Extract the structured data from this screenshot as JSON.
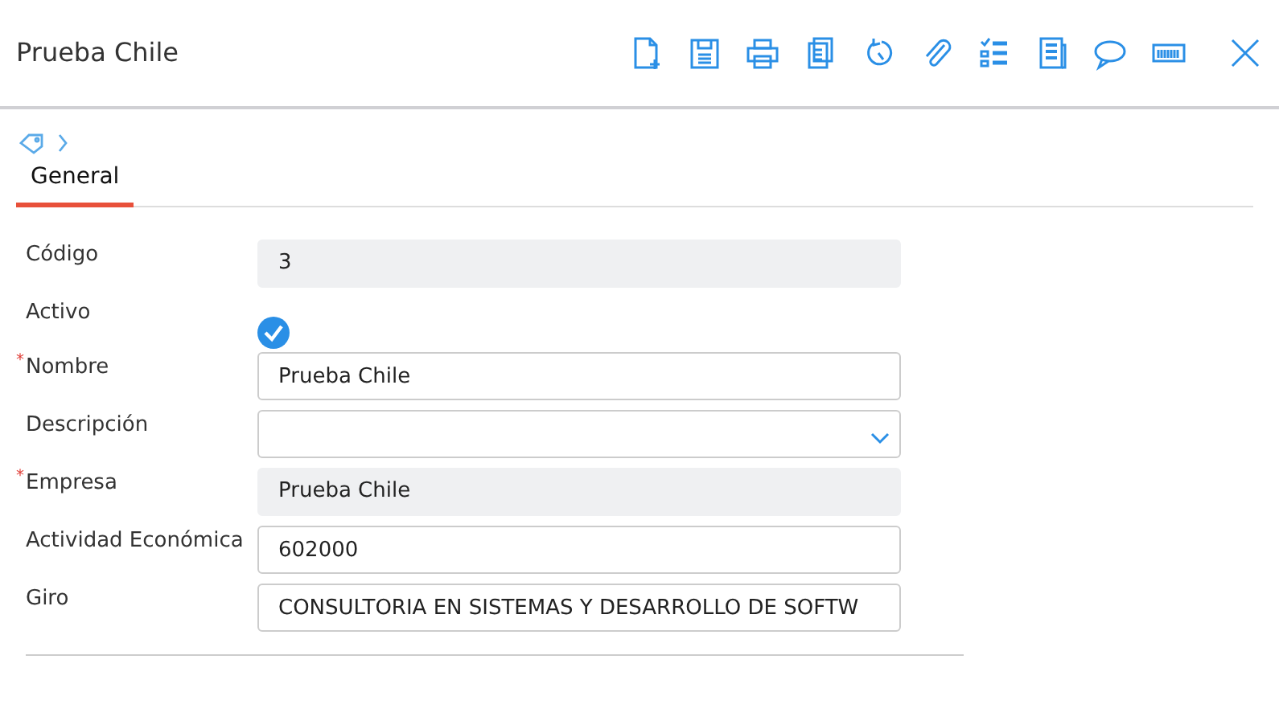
{
  "window": {
    "title": "Prueba Chile"
  },
  "tabs": [
    {
      "label": "General",
      "selected": true
    }
  ],
  "fields": [
    {
      "label": "Código",
      "kind": "readonly",
      "value": "3"
    },
    {
      "label": "Activo",
      "kind": "checkbox",
      "checked": true
    },
    {
      "label": "Nombre",
      "kind": "text",
      "required_mark": "*",
      "value": "Prueba Chile"
    },
    {
      "label": "Descripción",
      "kind": "select"
    },
    {
      "label": "Empresa",
      "kind": "readonly",
      "required_mark": "*",
      "value": "Prueba Chile"
    },
    {
      "label": "Actividad Económica",
      "kind": "text",
      "value": "602000"
    },
    {
      "label": "Giro",
      "kind": "text",
      "value": "CONSULTORIA EN SISTEMAS Y DESARROLLO DE SOFTW"
    }
  ]
}
